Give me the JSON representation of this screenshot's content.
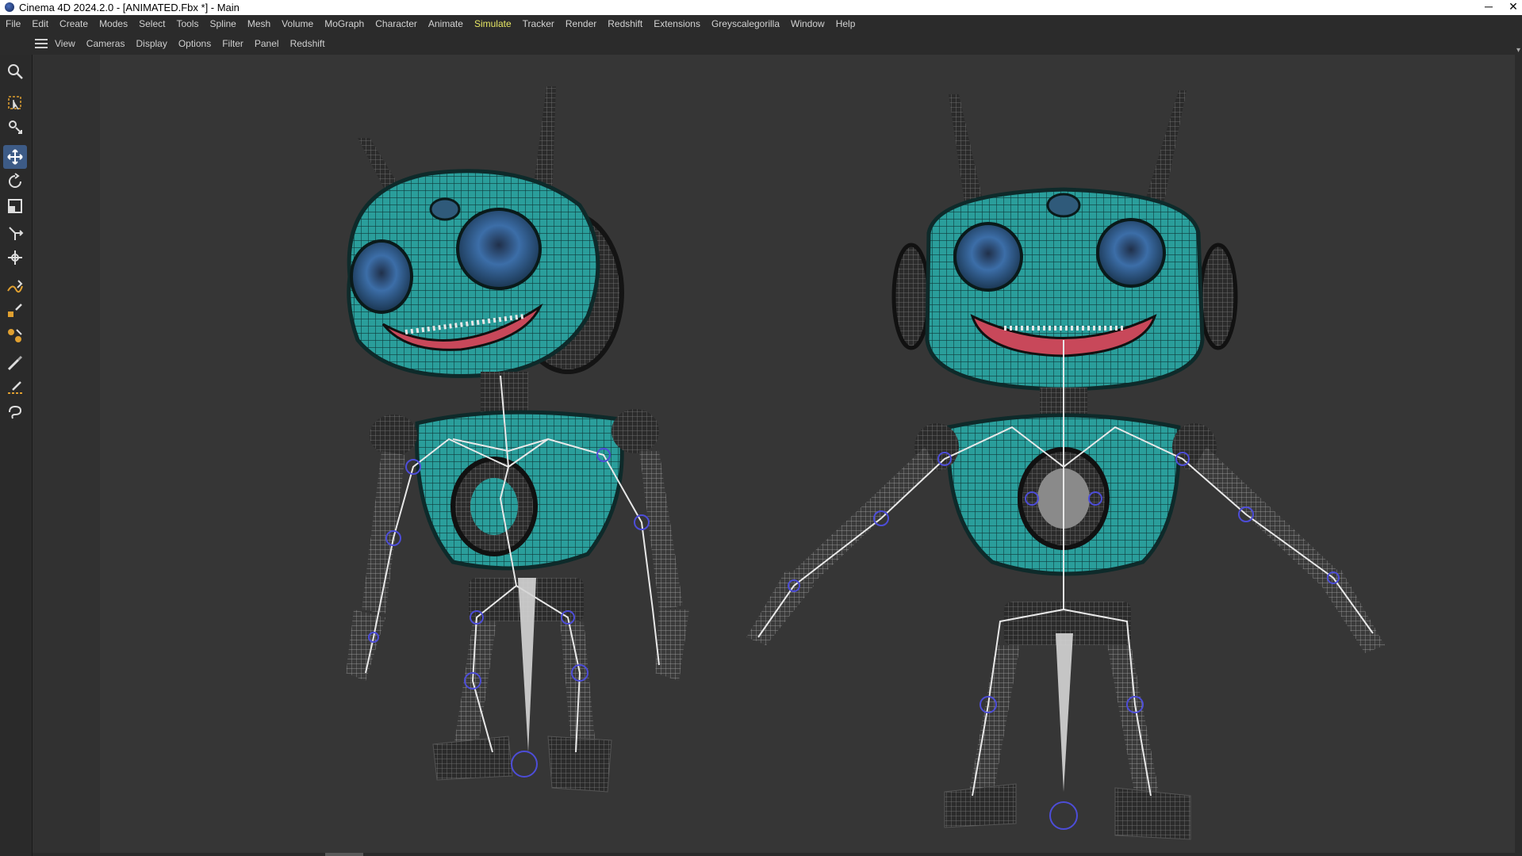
{
  "window": {
    "title": "Cinema 4D 2024.2.0 - [ANIMATED.Fbx *] - Main",
    "minimize_symbol": "─",
    "close_symbol": "✕"
  },
  "menubar": {
    "items": [
      "File",
      "Edit",
      "Create",
      "Modes",
      "Select",
      "Tools",
      "Spline",
      "Mesh",
      "Volume",
      "MoGraph",
      "Character",
      "Animate",
      "Simulate",
      "Tracker",
      "Render",
      "Redshift",
      "Extensions",
      "Greyscalegorilla",
      "Window",
      "Help"
    ],
    "active": "Simulate"
  },
  "viewport_menu": {
    "items": [
      "View",
      "Cameras",
      "Display",
      "Options",
      "Filter",
      "Panel",
      "Redshift"
    ]
  },
  "tools": [
    {
      "name": "zoom-icon",
      "active": false
    },
    {
      "name": "live-selection-icon",
      "active": false
    },
    {
      "name": "transform-settings-icon",
      "active": false
    },
    {
      "name": "move-icon",
      "active": true
    },
    {
      "name": "rotate-icon",
      "active": false
    },
    {
      "name": "scale-icon",
      "active": false
    },
    {
      "name": "axis-move-icon",
      "active": false
    },
    {
      "name": "multi-transform-icon",
      "active": false
    },
    {
      "name": "spline-pen-icon",
      "active": false
    },
    {
      "name": "spline-draw-icon",
      "active": false
    },
    {
      "name": "primitive-spline-icon",
      "active": false
    },
    {
      "name": "paint-brush-icon",
      "active": false
    },
    {
      "name": "knife-icon",
      "active": false
    },
    {
      "name": "lasso-icon",
      "active": false
    }
  ],
  "colors": {
    "accent_active": "#3d5b86",
    "menu_active_text": "#e6e664",
    "robot_body_teal": "#2a9e9b",
    "viewport_bg": "#363636"
  }
}
